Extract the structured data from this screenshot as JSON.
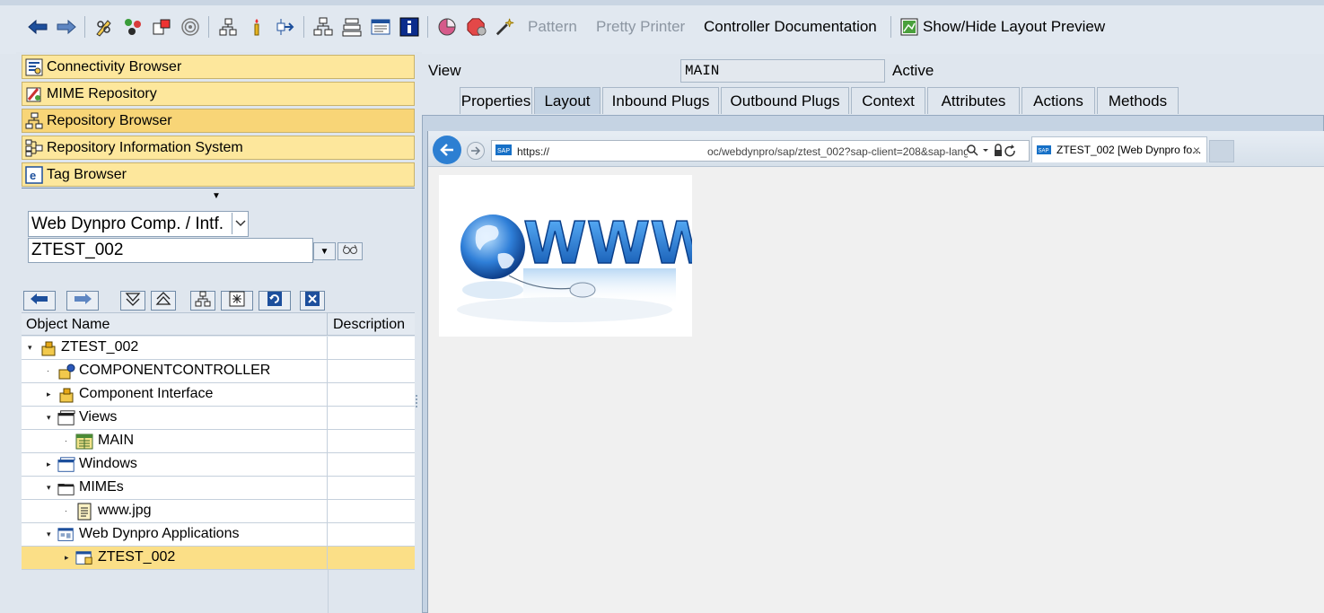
{
  "toolbar": {
    "pattern_label": "Pattern",
    "pretty_printer_label": "Pretty Printer",
    "controller_doc_label": "Controller Documentation",
    "layout_preview_label": "Show/Hide Layout Preview"
  },
  "nav": {
    "items": [
      {
        "label": "Connectivity Browser"
      },
      {
        "label": "MIME Repository"
      },
      {
        "label": "Repository Browser"
      },
      {
        "label": "Repository Information System"
      },
      {
        "label": "Tag Browser"
      }
    ]
  },
  "object_type": {
    "selected": "Web Dynpro Comp. / Intf."
  },
  "object_name": {
    "value": "ZTEST_002"
  },
  "tree": {
    "col_name": "Object Name",
    "col_desc": "Description",
    "rows": [
      {
        "label": "ZTEST_002"
      },
      {
        "label": "COMPONENTCONTROLLER"
      },
      {
        "label": "Component Interface"
      },
      {
        "label": "Views"
      },
      {
        "label": "MAIN"
      },
      {
        "label": "Windows"
      },
      {
        "label": "MIMEs"
      },
      {
        "label": "www.jpg"
      },
      {
        "label": "Web Dynpro Applications"
      },
      {
        "label": "ZTEST_002"
      }
    ]
  },
  "editor": {
    "view_label": "View",
    "view_value": "MAIN",
    "status": "Active",
    "tabs": [
      "Properties",
      "Layout",
      "Inbound Plugs",
      "Outbound Plugs",
      "Context",
      "Attributes",
      "Actions",
      "Methods"
    ],
    "active_tab": "Layout"
  },
  "browser": {
    "url_prefix": "https://",
    "url_suffix": "oc/webdynpro/sap/ztest_002?sap-client=208&sap-lang",
    "tab_title": "ZTEST_002 [Web Dynpro fo...",
    "tab_close": "×"
  },
  "image": {
    "text": "WWW"
  },
  "colors": {
    "nav_button": "#fde79c",
    "selection": "#fbdf87",
    "tab_active": "#c4d3e3",
    "ie_back": "#2d7fd2"
  }
}
